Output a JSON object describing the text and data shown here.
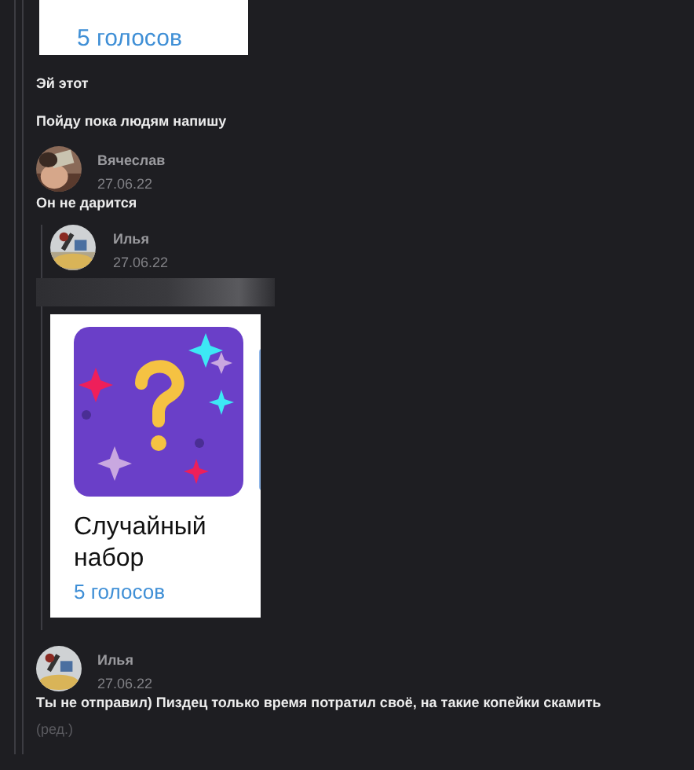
{
  "top_card": {
    "votes": "5 голосов"
  },
  "messages": [
    {
      "kind": "text",
      "text": "Эй этот"
    },
    {
      "kind": "text",
      "text": "Пойду пока людям напишу"
    },
    {
      "kind": "author",
      "name": "Вячеслав",
      "date": "27.06.22"
    },
    {
      "kind": "text",
      "text": "Он не дарится"
    }
  ],
  "quote": {
    "name": "Илья",
    "date": "27.06.22",
    "card": {
      "title": "Случайный набор",
      "votes": "5 голосов"
    }
  },
  "reply": {
    "name": "Илья",
    "date": "27.06.22",
    "text": "Ты не отправил) Пиздец только время потратил своё, на такие копейки скамить",
    "edited": "(ред.)"
  }
}
